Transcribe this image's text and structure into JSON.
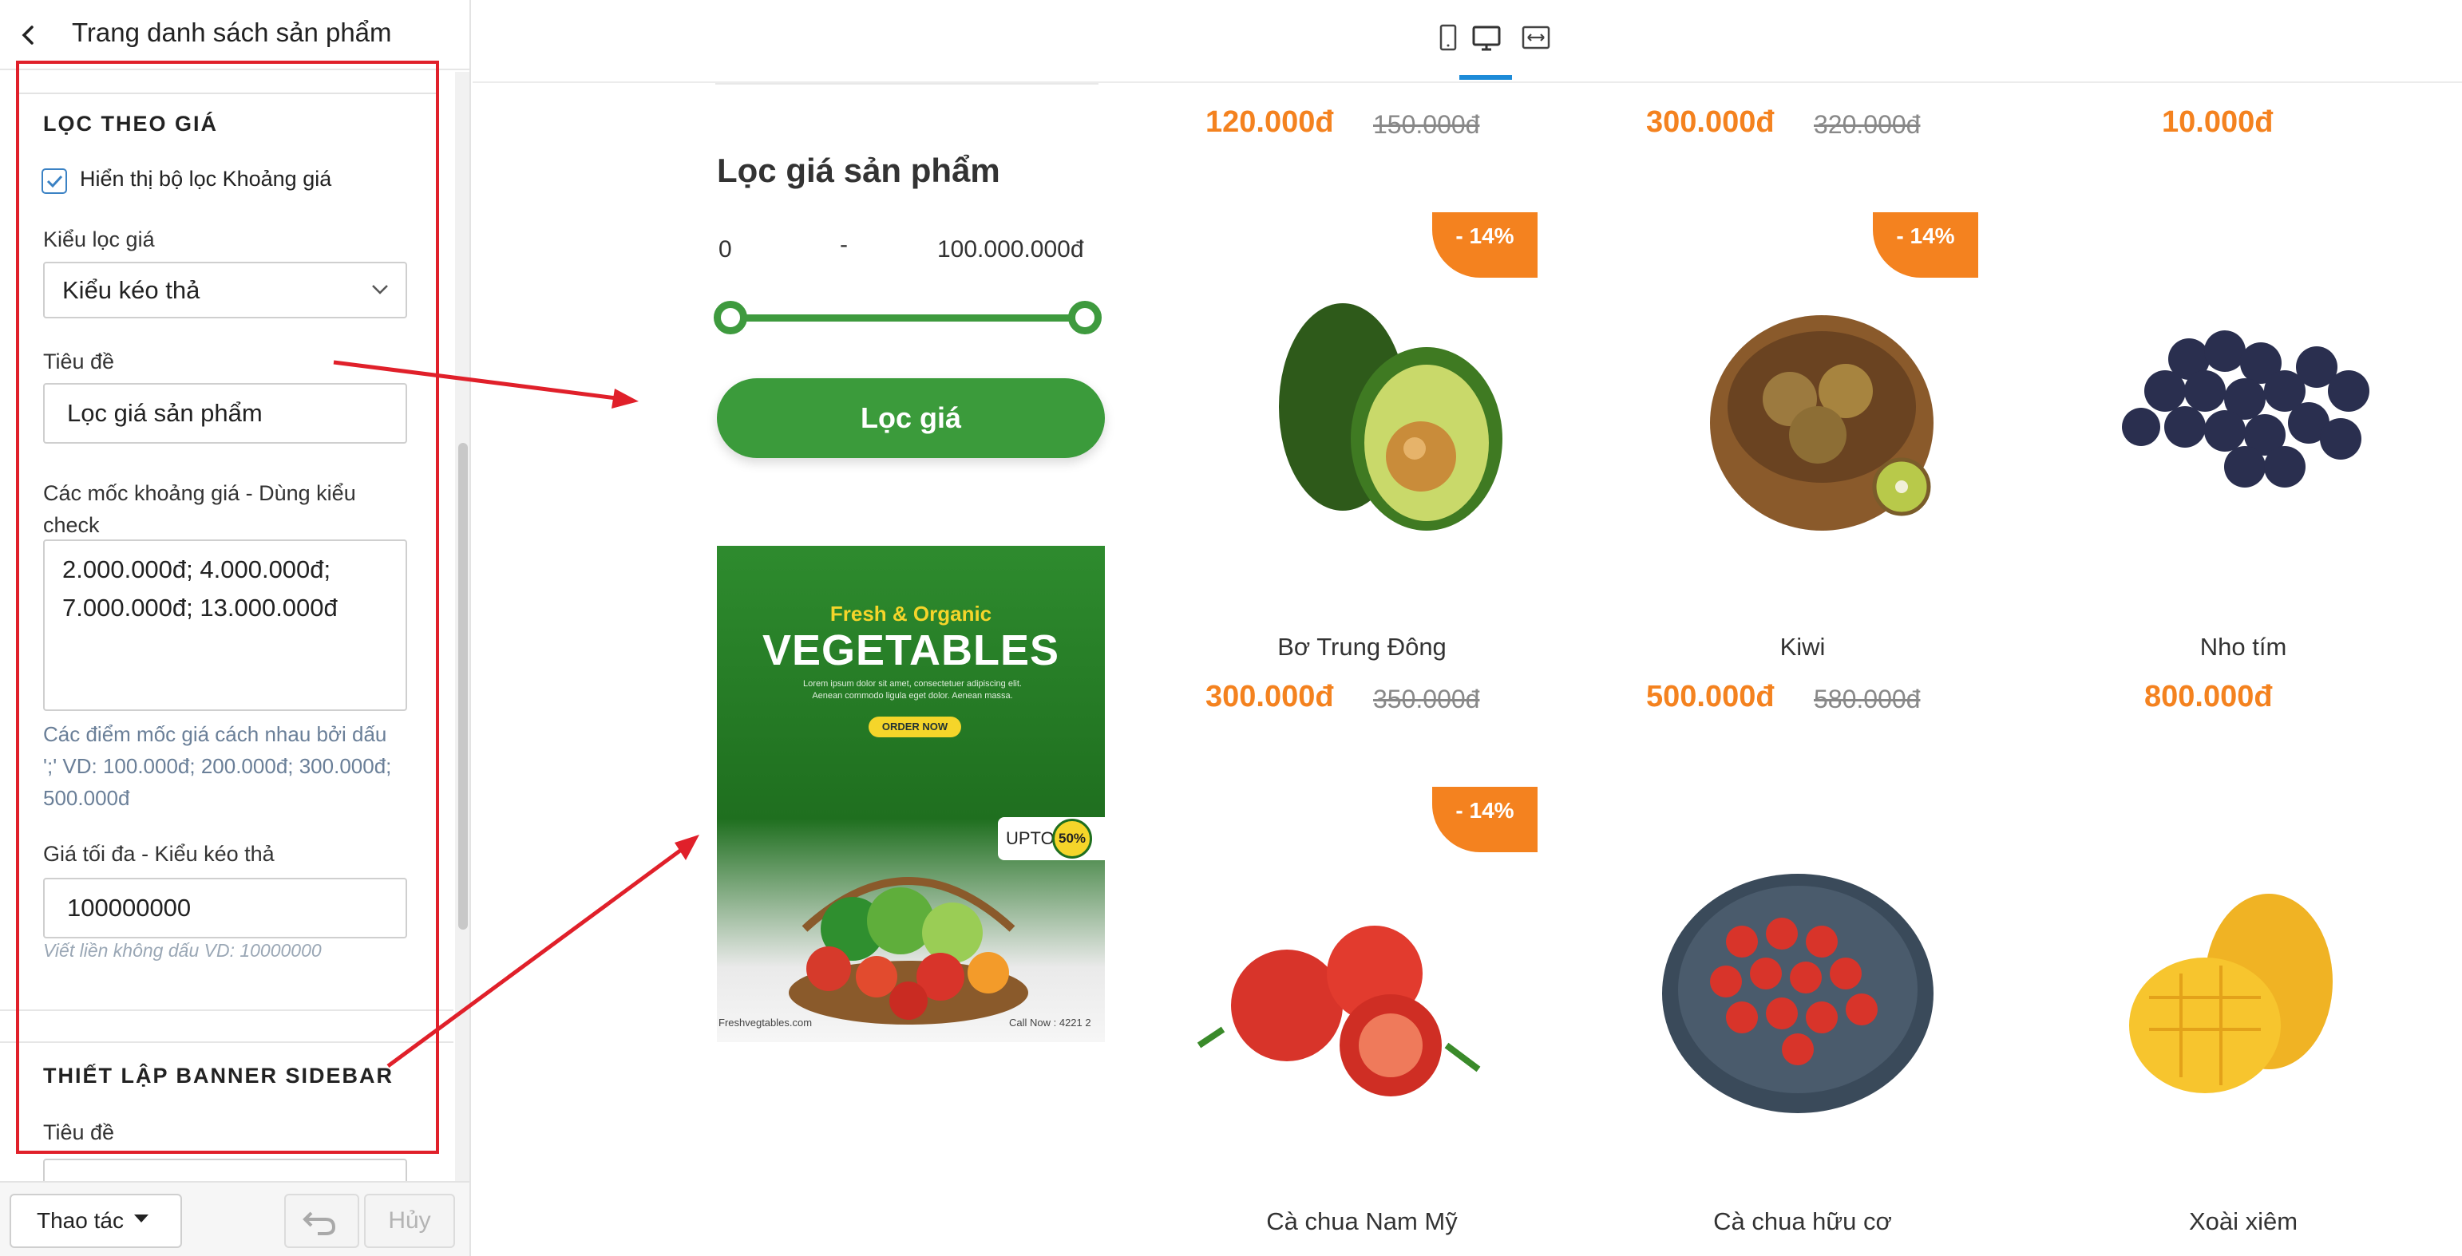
{
  "panel": {
    "title": "Trang danh sách sản phẩm",
    "filter_section": {
      "heading": "LỌC THEO GIÁ",
      "show_filter_label": "Hiển thị bộ lọc Khoảng giá",
      "show_filter_checked": true,
      "type_label": "Kiểu lọc giá",
      "type_value": "Kiểu kéo thả",
      "title_label": "Tiêu đề",
      "title_value": "Lọc giá sản phẩm",
      "ranges_label": "Các mốc khoảng giá - Dùng kiểu check",
      "ranges_value": "2.000.000đ; 4.000.000đ; 7.000.000đ; 13.000.000đ",
      "ranges_hint": "Các điểm mốc giá cách nhau bởi dấu ';' VD: 100.000đ; 200.000đ; 300.000đ; 500.000đ",
      "max_label": "Giá tối đa - Kiểu kéo thả",
      "max_value": "100000000",
      "max_hint": "Viết liền không dấu VD: 10000000"
    },
    "banner_section": {
      "heading": "THIẾT LẬP BANNER SIDEBAR",
      "title_label": "Tiêu đề"
    },
    "footer": {
      "action_label": "Thao tác",
      "cancel_label": "Hủy"
    }
  },
  "preview": {
    "filter_title": "Lọc giá sản phẩm",
    "price_min": "0",
    "price_sep": "-",
    "price_max": "100.000.000đ",
    "filter_button": "Lọc giá",
    "banner": {
      "fresh": "Fresh & Organic",
      "headline": "VEGETABLES",
      "lorem": "Lorem ipsum dolor sit amet, consectetuer adipiscing elit. Aenean commodo ligula eget dolor. Aenean massa.",
      "order": "ORDER NOW",
      "upto": "UPTO",
      "percent": "50%",
      "site": "Freshvegtables.com",
      "call": "Call Now : 4221 2"
    },
    "top_row": [
      {
        "price": "120.000đ",
        "old": "150.000đ"
      },
      {
        "price": "300.000đ",
        "old": "320.000đ"
      },
      {
        "price": "10.000đ",
        "old": ""
      }
    ],
    "row2": [
      {
        "name": "Bơ Trung Đông",
        "price": "300.000đ",
        "old": "350.000đ",
        "badge": "- 14%"
      },
      {
        "name": "Kiwi",
        "price": "500.000đ",
        "old": "580.000đ",
        "badge": "- 14%"
      },
      {
        "name": "Nho tím",
        "price": "800.000đ",
        "old": "",
        "badge": ""
      }
    ],
    "row3": [
      {
        "name": "Cà chua Nam Mỹ",
        "badge": "- 14%"
      },
      {
        "name": "Cà chua hữu cơ",
        "badge": ""
      },
      {
        "name": "Xoài xiêm",
        "badge": ""
      }
    ]
  },
  "colors": {
    "accent_green": "#3b9b3b",
    "price_orange": "#f4821f",
    "highlight_red": "#e0202a",
    "tab_blue": "#1d8bd8"
  }
}
